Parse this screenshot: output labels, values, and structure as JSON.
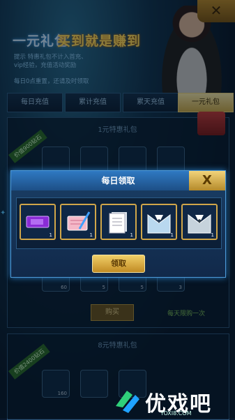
{
  "banner": {
    "title_part1": "一元礼包",
    "title_part2": "买到就是赚到",
    "tips_line1": "提示 特惠礼包不计入首充、",
    "tips_line2": "vip经验，充值活动奖励",
    "tips_line3": "每日0点重置，还请及时领取"
  },
  "tabs": [
    {
      "label": "每日充值",
      "active": false
    },
    {
      "label": "累计充值",
      "active": false
    },
    {
      "label": "累天充值",
      "active": false
    },
    {
      "label": "一元礼包",
      "active": true
    }
  ],
  "pack1": {
    "title": "1元特惠礼包",
    "ribbon": "价值900钻石",
    "counts": [
      "60",
      "5",
      "5",
      "3"
    ],
    "buy_label": "购买",
    "limit": "每天限购一次"
  },
  "pack2": {
    "title": "8元特惠礼包",
    "ribbon": "价值2400钻石",
    "counts": [
      "160"
    ]
  },
  "modal": {
    "title": "每日领取",
    "close_glyph": "X",
    "items": [
      {
        "icon": "purple-ticket-icon",
        "count": "1"
      },
      {
        "icon": "pink-card-pen-icon",
        "count": "1"
      },
      {
        "icon": "paper-stack-icon",
        "count": "1"
      },
      {
        "icon": "suit-icon",
        "count": "1"
      },
      {
        "icon": "suit-icon",
        "count": "1"
      }
    ],
    "claim_label": "领取"
  },
  "watermark": {
    "text": "优戏吧",
    "url": "YOXI8.COM"
  },
  "colors": {
    "accent_gold": "#d0a649",
    "modal_blue": "#1a3f66",
    "active_tab": "#f2e4a8"
  }
}
